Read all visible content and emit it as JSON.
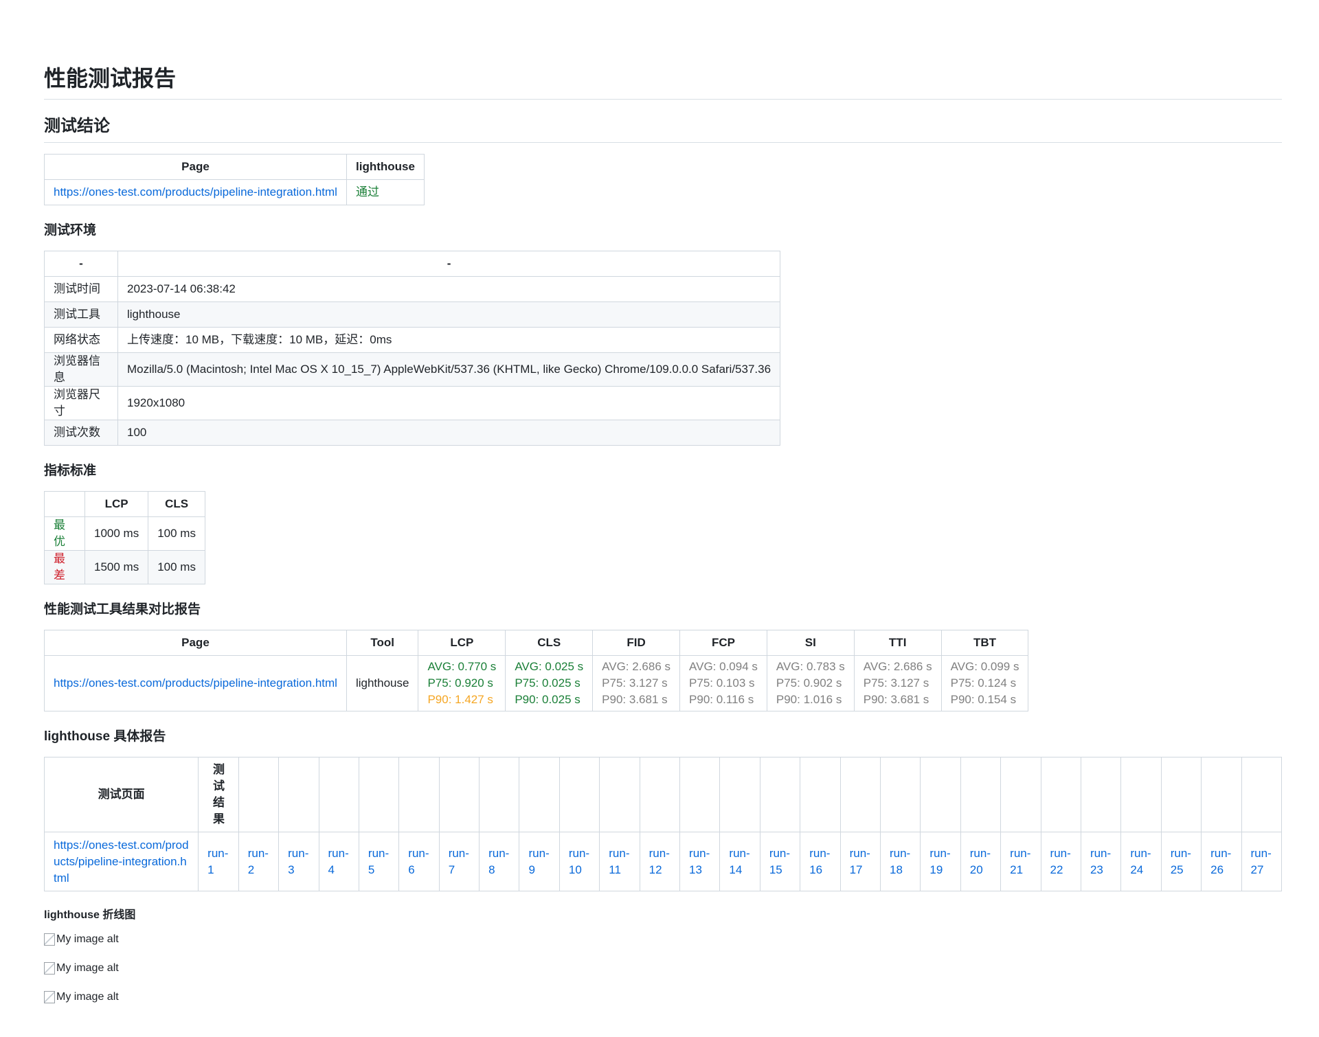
{
  "title": "性能测试报告",
  "conclusion": {
    "heading": "测试结论",
    "headers": [
      "Page",
      "lighthouse"
    ],
    "rows": [
      {
        "page": "https://ones-test.com/products/pipeline-integration.html",
        "result": "通过"
      }
    ]
  },
  "environment": {
    "heading": "测试环境",
    "headers": [
      "-",
      "-"
    ],
    "rows": [
      {
        "key": "测试时间",
        "value": "2023-07-14 06:38:42"
      },
      {
        "key": "测试工具",
        "value": "lighthouse"
      },
      {
        "key": "网络状态",
        "value": "上传速度：10 MB，下载速度：10 MB，延迟：0ms"
      },
      {
        "key": "浏览器信息",
        "value": "Mozilla/5.0 (Macintosh; Intel Mac OS X 10_15_7) AppleWebKit/537.36 (KHTML, like Gecko) Chrome/109.0.0.0 Safari/537.36"
      },
      {
        "key": "浏览器尺寸",
        "value": "1920x1080"
      },
      {
        "key": "测试次数",
        "value": "100"
      }
    ]
  },
  "standards": {
    "heading": "指标标准",
    "headers": [
      "",
      "LCP",
      "CLS"
    ],
    "rows": [
      {
        "label": "最优",
        "lcp": "1000 ms",
        "cls": "100 ms"
      },
      {
        "label": "最差",
        "lcp": "1500 ms",
        "cls": "100 ms"
      }
    ]
  },
  "comparison": {
    "heading": "性能测试工具结果对比报告",
    "headers": [
      "Page",
      "Tool",
      "LCP",
      "CLS",
      "FID",
      "FCP",
      "SI",
      "TTI",
      "TBT"
    ],
    "row": {
      "page": "https://ones-test.com/products/pipeline-integration.html",
      "tool": "lighthouse",
      "metrics": [
        {
          "avg": "AVG: 0.770 s",
          "p75": "P75: 0.920 s",
          "p90": "P90: 1.427 s",
          "c_avg": "good",
          "c_p75": "good",
          "c_p90": "warn"
        },
        {
          "avg": "AVG: 0.025 s",
          "p75": "P75: 0.025 s",
          "p90": "P90: 0.025 s",
          "c_avg": "good",
          "c_p75": "good",
          "c_p90": "good"
        },
        {
          "avg": "AVG: 2.686 s",
          "p75": "P75: 3.127 s",
          "p90": "P90: 3.681 s",
          "c_avg": "muted",
          "c_p75": "muted",
          "c_p90": "muted"
        },
        {
          "avg": "AVG: 0.094 s",
          "p75": "P75: 0.103 s",
          "p90": "P90: 0.116 s",
          "c_avg": "muted",
          "c_p75": "muted",
          "c_p90": "muted"
        },
        {
          "avg": "AVG: 0.783 s",
          "p75": "P75: 0.902 s",
          "p90": "P90: 1.016 s",
          "c_avg": "muted",
          "c_p75": "muted",
          "c_p90": "muted"
        },
        {
          "avg": "AVG: 2.686 s",
          "p75": "P75: 3.127 s",
          "p90": "P90: 3.681 s",
          "c_avg": "muted",
          "c_p75": "muted",
          "c_p90": "muted"
        },
        {
          "avg": "AVG: 0.099 s",
          "p75": "P75: 0.124 s",
          "p90": "P90: 0.154 s",
          "c_avg": "muted",
          "c_p75": "muted",
          "c_p90": "muted"
        }
      ]
    }
  },
  "details": {
    "heading": "lighthouse 具体报告",
    "header_page": "测试页面",
    "header_result": "测试结果",
    "page": "https://ones-test.com/products/pipeline-integration.html",
    "runs": [
      "run-1",
      "run-2",
      "run-3",
      "run-4",
      "run-5",
      "run-6",
      "run-7",
      "run-8",
      "run-9",
      "run-10",
      "run-11",
      "run-12",
      "run-13",
      "run-14",
      "run-15",
      "run-16",
      "run-17",
      "run-18",
      "run-19",
      "run-20",
      "run-21",
      "run-22",
      "run-23",
      "run-24",
      "run-25",
      "run-26",
      "run-27"
    ]
  },
  "linechart": {
    "heading": "lighthouse 折线图",
    "images": [
      "My image alt",
      "My image alt",
      "My image alt"
    ]
  }
}
